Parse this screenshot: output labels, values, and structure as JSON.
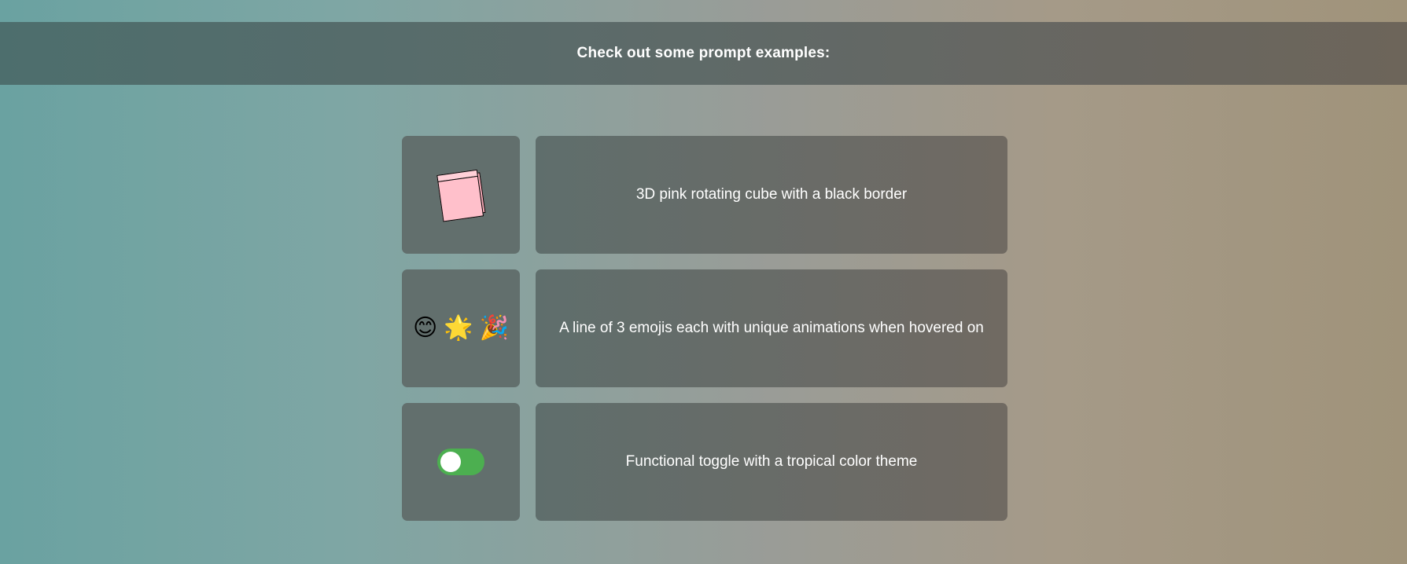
{
  "header": {
    "title": "Check out some prompt examples:"
  },
  "examples": [
    {
      "preview": "pink-cube",
      "prompt": "3D pink rotating cube with a black border"
    },
    {
      "preview": "emoji-line",
      "emojis": [
        "😊",
        "🌟",
        "🎉"
      ],
      "prompt": "A line of 3 emojis each with unique animations when hovered on"
    },
    {
      "preview": "toggle",
      "toggle_on": true,
      "prompt": "Functional toggle with a tropical color theme"
    }
  ],
  "colors": {
    "cube": "#ffc0cb",
    "toggle": "#4caf50",
    "card": "#626f6d"
  }
}
